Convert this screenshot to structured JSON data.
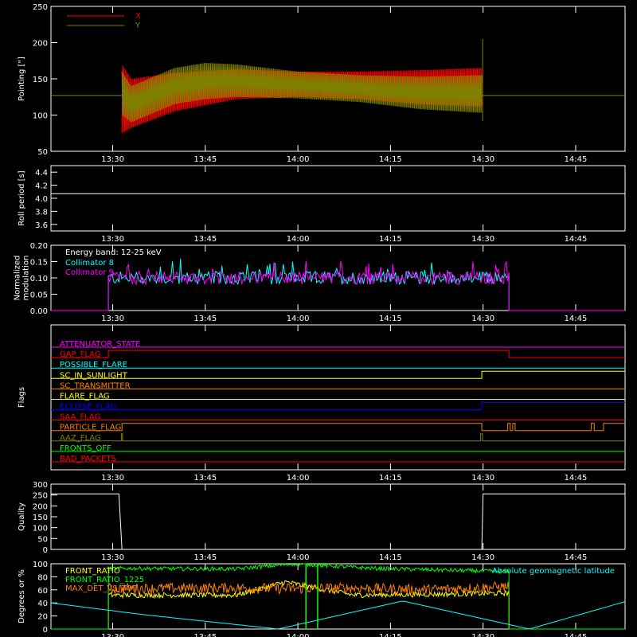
{
  "x_ticks": [
    "13:30",
    "13:45",
    "14:00",
    "14:15",
    "14:30",
    "14:45"
  ],
  "x_tick_minutes": [
    810,
    825,
    840,
    855,
    870,
    885
  ],
  "x_range_minutes": [
    800,
    893
  ],
  "colors": {
    "background": "#000000",
    "axis": "#ffffff",
    "red": "#ff0000",
    "olive": "#808000",
    "cyan": "#00ffff",
    "magenta": "#ff00ff",
    "green": "#00ff00",
    "yellow": "#ffff00",
    "orange": "#ff8000",
    "blue": "#0000ff"
  },
  "chart_data": [
    {
      "type": "line",
      "ylabel": "Pointing [\"]",
      "ylim": [
        50,
        250
      ],
      "yticks": [
        "50",
        "100",
        "150",
        "200",
        "250"
      ],
      "legend": [
        {
          "name": "X",
          "color": "#ff0000"
        },
        {
          "name": "Y",
          "color": "#808000"
        }
      ],
      "baseline_y": 127,
      "active_range": [
        811.5,
        869.8
      ],
      "x_envelope": {
        "x": [
          811.5,
          813,
          820,
          830,
          840,
          850,
          860,
          869.8
        ],
        "low": [
          75,
          82,
          105,
          122,
          125,
          122,
          115,
          112
        ],
        "high": [
          170,
          150,
          158,
          163,
          160,
          160,
          162,
          165
        ]
      },
      "y_envelope": {
        "x": [
          811.5,
          813,
          820,
          825,
          830,
          840,
          850,
          860,
          869.8
        ],
        "low": [
          100,
          90,
          115,
          122,
          125,
          123,
          118,
          108,
          103
        ],
        "high": [
          160,
          140,
          165,
          172,
          170,
          160,
          155,
          153,
          155
        ]
      }
    },
    {
      "type": "line",
      "ylabel": "Roll period [s]",
      "ylim": [
        3.5,
        4.5
      ],
      "yticks": [
        "3.6",
        "3.8",
        "4.0",
        "4.2",
        "4.4"
      ],
      "value": 4.07
    },
    {
      "type": "bar",
      "ylabel_lines": [
        "Normalized",
        "modulation"
      ],
      "ylim": [
        0.0,
        0.2
      ],
      "yticks": [
        "0.00",
        "0.05",
        "0.10",
        "0.15",
        "0.20"
      ],
      "annotation": "Energy band: 12-25 keV",
      "legend": [
        {
          "name": "Collimator 8",
          "color": "#00ffff"
        },
        {
          "name": "Collimator 9",
          "color": "#ff00ff"
        }
      ],
      "active_range": [
        809.3,
        874.2
      ],
      "mean": 0.1,
      "spread": 0.02
    },
    {
      "type": "line",
      "ylabel": "Flags",
      "flags": [
        {
          "name": "ATTENUATOR_STATE",
          "color": "#ff00ff",
          "changes": []
        },
        {
          "name": "GAP_FLAG",
          "color": "#ff0000",
          "changes": [
            [
              809.3,
              1
            ],
            [
              874.2,
              0
            ]
          ]
        },
        {
          "name": "POSSIBLE_FLARE",
          "color": "#00ffff",
          "changes": []
        },
        {
          "name": "SC_IN_SUNLIGHT",
          "color": "#ffff00",
          "changes": [
            [
              811.5,
              0
            ],
            [
              869.8,
              1
            ]
          ]
        },
        {
          "name": "SC_TRANSMITTER",
          "color": "#ff8000",
          "changes": []
        },
        {
          "name": "FLARE_FLAG",
          "color": "#ffff00",
          "changes": []
        },
        {
          "name": "ECLIPSE_FLAG",
          "color": "#0000ff",
          "changes": [
            [
              811.5,
              0
            ],
            [
              869.8,
              1
            ]
          ]
        },
        {
          "name": "SAA_FLAG",
          "color": "#ff0000",
          "changes": []
        },
        {
          "name": "PARTICLE_FLAG",
          "color": "#ff8000",
          "changes": [
            [
              811.5,
              1
            ],
            [
              869.8,
              0
            ],
            [
              874.0,
              1
            ],
            [
              874.4,
              0
            ],
            [
              874.8,
              1
            ],
            [
              875.2,
              0
            ],
            [
              887.5,
              1
            ],
            [
              888.0,
              0
            ],
            [
              889.5,
              1
            ]
          ]
        },
        {
          "name": "AAZ_FLAG",
          "color": "#808000",
          "changes": [
            [
              811.4,
              1
            ],
            [
              811.6,
              0
            ],
            [
              869.6,
              1
            ],
            [
              869.9,
              0
            ]
          ]
        },
        {
          "name": "FRONTS_OFF",
          "color": "#00ff00",
          "changes": []
        },
        {
          "name": "BAD_PACKETS",
          "color": "#ff0000",
          "changes": []
        }
      ]
    },
    {
      "type": "line",
      "ylabel": "Quality",
      "ylim": [
        0,
        300
      ],
      "yticks": [
        "0",
        "50",
        "100",
        "150",
        "200",
        "250",
        "300"
      ],
      "x": [
        800,
        811.0,
        811.5,
        869.8,
        870.0,
        893
      ],
      "y": [
        255,
        255,
        0,
        0,
        255,
        255
      ]
    },
    {
      "type": "line",
      "ylabel": "Degrees or %",
      "ylim": [
        0,
        100
      ],
      "yticks": [
        "0",
        "20",
        "40",
        "60",
        "80",
        "100"
      ],
      "legend": [
        {
          "name": "FRONT_RATIO",
          "color": "#ffff00"
        },
        {
          "name": "FRONT_RATIO_1225",
          "color": "#00ff00"
        },
        {
          "name": "MAX_DET_VS_TOT",
          "color": "#ff8000"
        }
      ],
      "annotation": "Absolute geomagnetic latitude",
      "active_range": [
        809.3,
        874.2
      ],
      "front_ratio_1225": {
        "x": [
          809.3,
          830,
          839.5,
          852,
          874.2
        ],
        "y": [
          93,
          92,
          100,
          93,
          88
        ]
      },
      "front_ratio": {
        "x": [
          809.3,
          830,
          838,
          849,
          860,
          874.2
        ],
        "y": [
          52,
          52,
          72,
          52,
          53,
          55
        ]
      },
      "max_det_vs_tot": {
        "x": [
          809.3,
          830,
          838,
          849,
          860,
          874.2
        ],
        "y": [
          62,
          63,
          62,
          63,
          60,
          65
        ]
      },
      "green_spikes": [
        841.3,
        843.2
      ],
      "geomag_latitude": {
        "x": [
          800,
          815,
          836.8,
          857,
          877.5,
          893
        ],
        "y": [
          40,
          22,
          0,
          43,
          0,
          42
        ]
      }
    }
  ]
}
